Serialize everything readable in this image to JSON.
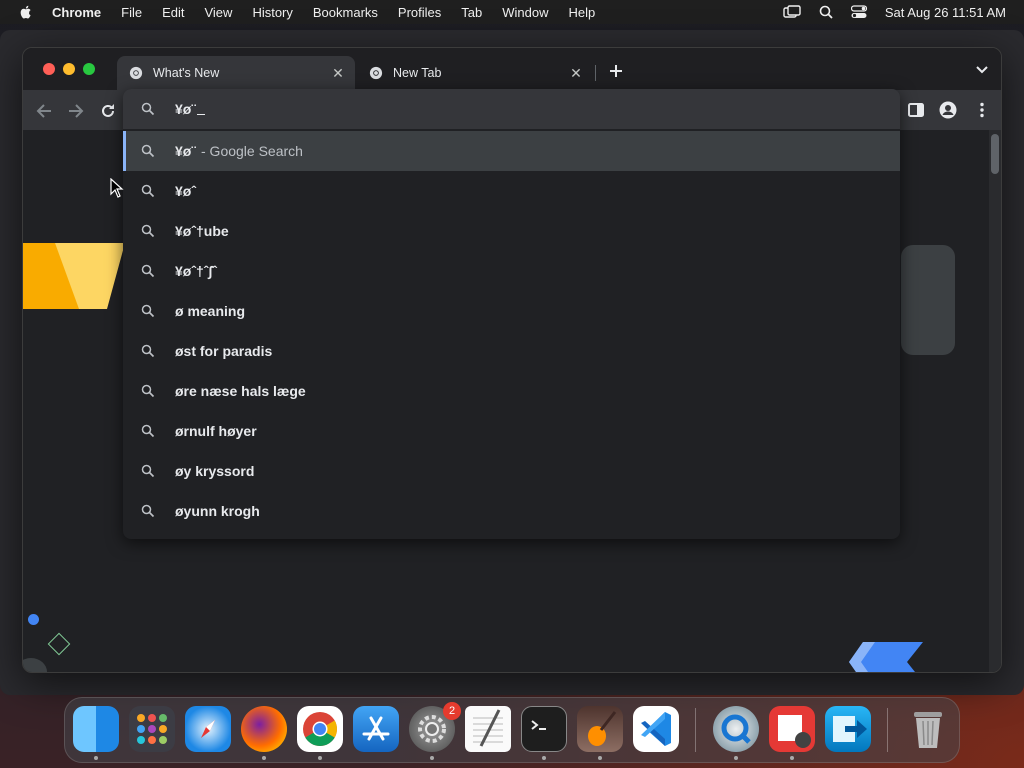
{
  "menubar": {
    "app_name": "Chrome",
    "items": [
      "File",
      "Edit",
      "View",
      "History",
      "Bookmarks",
      "Profiles",
      "Tab",
      "Window",
      "Help"
    ],
    "datetime": "Sat Aug 26  11:51 AM"
  },
  "tabs": [
    {
      "title": "What's New",
      "active": true
    },
    {
      "title": "New Tab",
      "active": false
    }
  ],
  "omnibox": {
    "input_text": "¥ø¨",
    "suggestions": [
      {
        "text": "¥ø¨",
        "hint": "- Google Search",
        "selected": true
      },
      {
        "text": "¥øˆ",
        "hint": ""
      },
      {
        "text": "¥øˆ†ube",
        "hint": ""
      },
      {
        "text": "¥øˆ†ˆ∫ˆ",
        "hint": ""
      },
      {
        "text": "ø meaning",
        "hint": ""
      },
      {
        "text": "øst for paradis",
        "hint": ""
      },
      {
        "text": "øre næse hals læge",
        "hint": ""
      },
      {
        "text": "ørnulf høyer",
        "hint": ""
      },
      {
        "text": "øy kryssord",
        "hint": ""
      },
      {
        "text": "øyunn krogh",
        "hint": ""
      }
    ]
  },
  "dock": {
    "apps": [
      "Finder",
      "Launchpad",
      "Safari",
      "Firefox",
      "Chrome",
      "App Store",
      "System Settings",
      "TextEdit",
      "Terminal",
      "GarageBand",
      "Visual Studio Code",
      "QuickTime Player",
      "Photo Booth",
      "Migration Assistant",
      "Trash"
    ],
    "system_settings_badge": "2"
  },
  "colors": {
    "accent": "#8ab4f8",
    "window_bg": "#202124",
    "toolbar_bg": "#35363a"
  }
}
